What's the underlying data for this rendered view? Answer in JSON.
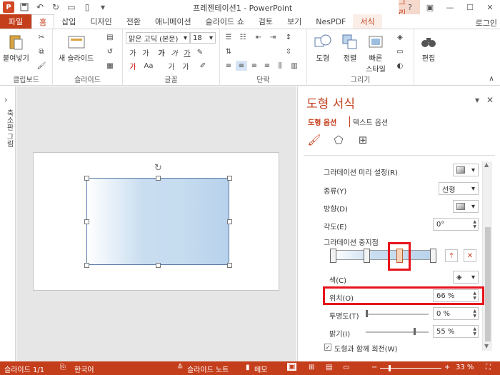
{
  "window": {
    "title": "프레젠테이션1 - PowerPoint",
    "context_tab": "그리...",
    "help": "?",
    "user": "로그인"
  },
  "qat": {
    "app_icon": "P"
  },
  "tabs": [
    {
      "label": "파일"
    },
    {
      "label": "홈"
    },
    {
      "label": "삽입"
    },
    {
      "label": "디자인"
    },
    {
      "label": "전환"
    },
    {
      "label": "애니메이션"
    },
    {
      "label": "슬라이드 쇼"
    },
    {
      "label": "검토"
    },
    {
      "label": "보기"
    },
    {
      "label": "NesPDF"
    },
    {
      "label": "서식"
    }
  ],
  "ribbon": {
    "clipboard": {
      "label": "클립보드",
      "paste": "붙여넣기"
    },
    "slides": {
      "label": "슬라이드",
      "new_slide": "새 슬라이드"
    },
    "font": {
      "label": "글꼴",
      "font_name": "맑은 고딕 (본문)",
      "font_size": "18"
    },
    "paragraph": {
      "label": "단락"
    },
    "drawing": {
      "label": "그리기",
      "shape": "도형",
      "arrange": "정렬",
      "quick_style_1": "빠른",
      "quick_style_2": "스타일"
    },
    "editing": {
      "label": "편집"
    }
  },
  "left_pane": {
    "label": "축소판 그림"
  },
  "format_pane": {
    "title": "도형 서식",
    "tab_shape": "도형 옵션",
    "tab_text": "텍스트 옵션",
    "preset_label": "그라데이션 미리 설정(R)",
    "type_label": "종류(Y)",
    "type_value": "선형",
    "direction_label": "방향(D)",
    "angle_label": "각도(E)",
    "angle_value": "0°",
    "stops_label": "그라데이션 중지점",
    "color_label": "색(C)",
    "position_label": "위치(O)",
    "position_value": "66 %",
    "transparency_label": "투명도(T)",
    "transparency_value": "0 %",
    "brightness_label": "밝기(I)",
    "brightness_value": "55 %",
    "rotate_label": "도형과 함께 회전(W)"
  },
  "status": {
    "slide": "슬라이드 1/1",
    "language": "한국어",
    "notes": "슬라이드 노트",
    "comments": "메모",
    "zoom": "33 %"
  }
}
